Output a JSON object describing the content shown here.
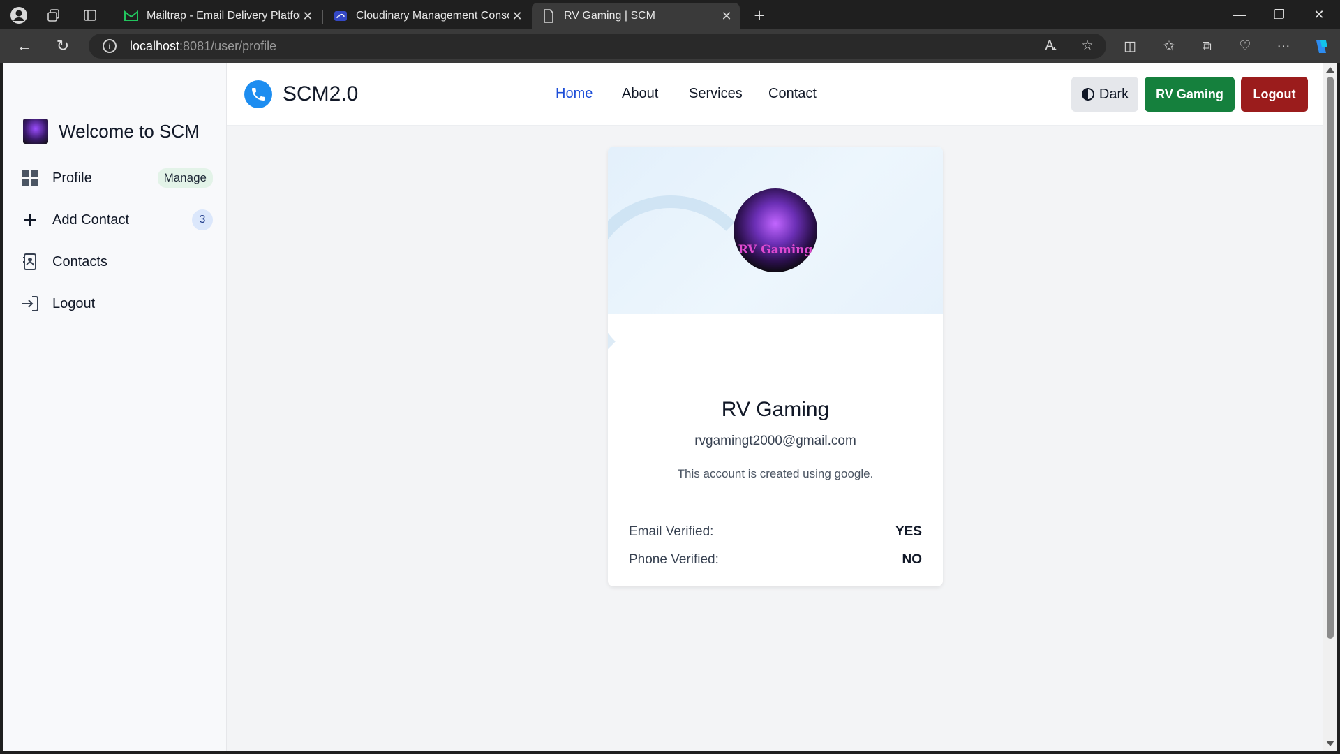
{
  "browser": {
    "tabs": [
      {
        "label": "Mailtrap - Email Delivery Platform",
        "favicon": "mailtrap-icon"
      },
      {
        "label": "Cloudinary Management Console",
        "favicon": "cloudinary-icon"
      },
      {
        "label": "RV Gaming | SCM",
        "favicon": "page-icon",
        "active": true
      }
    ],
    "url_host": "localhost",
    "url_rest": ":8081/user/profile"
  },
  "sidebar": {
    "title": "Welcome to SCM",
    "items": [
      {
        "label": "Profile",
        "icon": "grid-icon",
        "badge": "Manage"
      },
      {
        "label": "Add Contact",
        "icon": "plus-icon",
        "badge": "3"
      },
      {
        "label": "Contacts",
        "icon": "contacts-book-icon"
      },
      {
        "label": "Logout",
        "icon": "logout-arrow-icon"
      }
    ]
  },
  "navbar": {
    "brand": "SCM2.0",
    "links": [
      "Home",
      "About",
      "Services",
      "Contact"
    ],
    "active_link": "Home",
    "theme_button": "Dark",
    "user_button": "RV Gaming",
    "logout_button": "Logout"
  },
  "profile": {
    "name": "RV Gaming",
    "email": "rvgamingt2000@gmail.com",
    "note": "This account is created using google.",
    "avatar_text": "RV Gaming",
    "verifications": [
      {
        "label": "Email Verified:",
        "value": "YES"
      },
      {
        "label": "Phone Verified:",
        "value": "NO"
      }
    ]
  },
  "colors": {
    "accent": "#1d4ed8",
    "user_button": "#15803d",
    "logout_button": "#9b1c1c",
    "logo": "#1d8df0"
  }
}
